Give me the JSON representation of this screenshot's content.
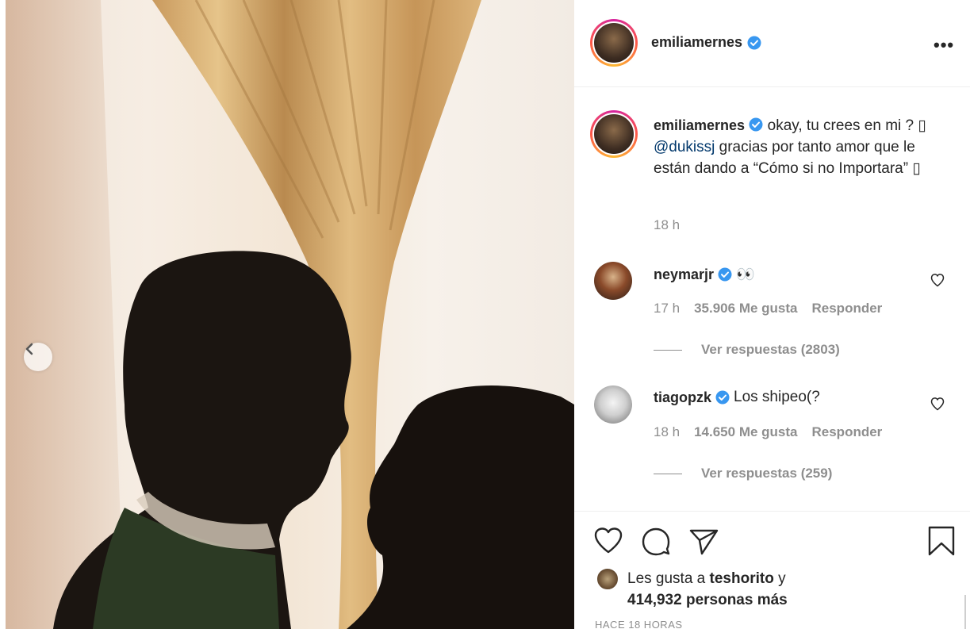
{
  "post": {
    "author": "emiliamernes",
    "more_label": "•••",
    "caption_text": "okay, tu crees en mi ? ",
    "caption_glyph1": "▯",
    "caption_mention": "@dukissj",
    "caption_rest": " gracias por tanto amor que le están dando a “Cómo si no Importara” ",
    "caption_glyph2": "▯",
    "caption_time": "18 h"
  },
  "comments": [
    {
      "username": "neymarjr",
      "text": "👀",
      "time": "17 h",
      "likes": "35.906 Me gusta",
      "reply_label": "Responder",
      "replies_label": "Ver respuestas (2803)"
    },
    {
      "username": "tiagopzk",
      "text": "Los shipeo(?",
      "time": "18 h",
      "likes": "14.650 Me gusta",
      "reply_label": "Responder",
      "replies_label": "Ver respuestas (259)"
    }
  ],
  "likes": {
    "prefix": "Les gusta a ",
    "user": "teshorito",
    "suffix": " y",
    "count": "414,932 personas más"
  },
  "timestamp": "HACE 18 HORAS",
  "colors": {
    "verified": "#3897f0",
    "mention": "#00376b",
    "secondary_text": "#8e8e8e"
  }
}
